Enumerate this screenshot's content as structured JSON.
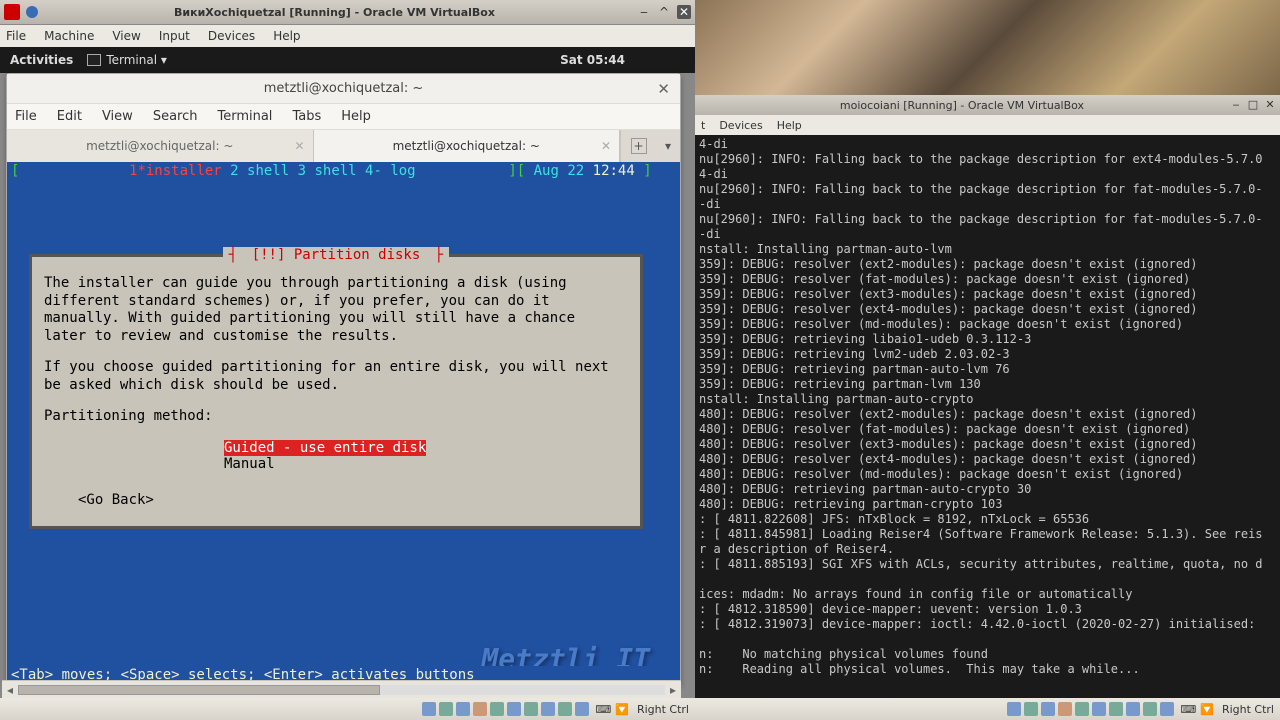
{
  "vb1": {
    "title": "ВикиXochiquetzal [Running] - Oracle VM VirtualBox",
    "menu": [
      "File",
      "Machine",
      "View",
      "Input",
      "Devices",
      "Help"
    ],
    "rightctrl": "Right Ctrl"
  },
  "gnome": {
    "activities": "Activities",
    "terminal": "Terminal ▾",
    "clock": "Sat 05:44"
  },
  "term": {
    "title": "metztli@xochiquetzal: ~",
    "menus": [
      "File",
      "Edit",
      "View",
      "Search",
      "Terminal",
      "Tabs",
      "Help"
    ],
    "tabs": [
      "metztli@xochiquetzal: ~",
      "metztli@xochiquetzal: ~"
    ]
  },
  "tmux": {
    "lb": "[",
    "sess": "1*installer",
    "w2": "  2 shell",
    "w3": "  3 shell",
    "w4": "  4- log",
    "rb": "][",
    "date": " Aug 22 ",
    "time": "12:44",
    "end": " ]"
  },
  "dialog": {
    "title": "[!!] Partition disks",
    "p1": "The installer can guide you through partitioning a disk (using\ndifferent standard schemes) or, if you prefer, you can do it\nmanually. With guided partitioning you will still have a chance\nlater to review and customise the results.",
    "p2": "If you choose guided partitioning for an entire disk, you will next\nbe asked which disk should be used.",
    "p3": "Partitioning method:",
    "opt1": "Guided - use entire disk",
    "opt2": "Manual",
    "goback": "<Go Back>"
  },
  "footer": "<Tab> moves; <Space> selects; <Enter> activates buttons",
  "watermark": "Metztli IT",
  "vb2": {
    "title": "moiocoiani [Running] - Oracle VM VirtualBox",
    "menu_partial": [
      "t",
      "Devices",
      "Help"
    ],
    "rightctrl": "Right Ctrl",
    "log": "4-di\nnu[2960]: INFO: Falling back to the package description for ext4-modules-5.7.0\n4-di\nnu[2960]: INFO: Falling back to the package description for fat-modules-5.7.0-\n-di\nnu[2960]: INFO: Falling back to the package description for fat-modules-5.7.0-\n-di\nnstall: Installing partman-auto-lvm\n359]: DEBUG: resolver (ext2-modules): package doesn't exist (ignored)\n359]: DEBUG: resolver (fat-modules): package doesn't exist (ignored)\n359]: DEBUG: resolver (ext3-modules): package doesn't exist (ignored)\n359]: DEBUG: resolver (ext4-modules): package doesn't exist (ignored)\n359]: DEBUG: resolver (md-modules): package doesn't exist (ignored)\n359]: DEBUG: retrieving libaio1-udeb 0.3.112-3\n359]: DEBUG: retrieving lvm2-udeb 2.03.02-3\n359]: DEBUG: retrieving partman-auto-lvm 76\n359]: DEBUG: retrieving partman-lvm 130\nnstall: Installing partman-auto-crypto\n480]: DEBUG: resolver (ext2-modules): package doesn't exist (ignored)\n480]: DEBUG: resolver (fat-modules): package doesn't exist (ignored)\n480]: DEBUG: resolver (ext3-modules): package doesn't exist (ignored)\n480]: DEBUG: resolver (ext4-modules): package doesn't exist (ignored)\n480]: DEBUG: resolver (md-modules): package doesn't exist (ignored)\n480]: DEBUG: retrieving partman-auto-crypto 30\n480]: DEBUG: retrieving partman-crypto 103\n: [ 4811.822608] JFS: nTxBlock = 8192, nTxLock = 65536\n: [ 4811.845981] Loading Reiser4 (Software Framework Release: 5.1.3). See reis\nr a description of Reiser4.\n: [ 4811.885193] SGI XFS with ACLs, security attributes, realtime, quota, no d\n\nices: mdadm: No arrays found in config file or automatically\n: [ 4812.318590] device-mapper: uevent: version 1.0.3\n: [ 4812.319073] device-mapper: ioctl: 4.42.0-ioctl (2020-02-27) initialised:\n\nn:    No matching physical volumes found\nn:    Reading all physical volumes.  This may take a while..."
  }
}
